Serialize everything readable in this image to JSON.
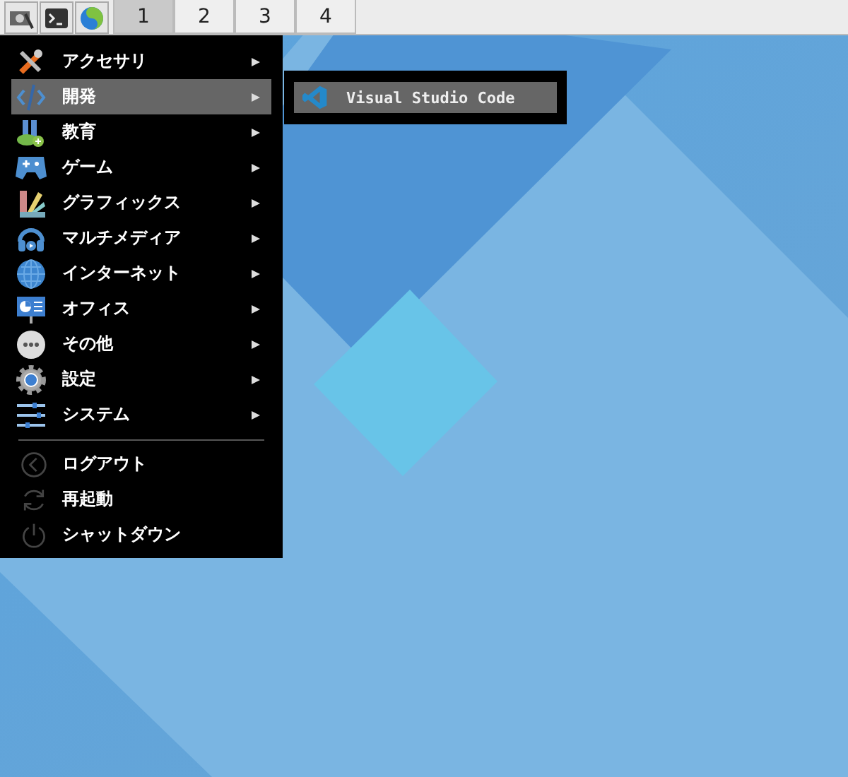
{
  "taskbar": {
    "workspaces": [
      {
        "label": "1",
        "selected": true
      },
      {
        "label": "2",
        "selected": false
      },
      {
        "label": "3",
        "selected": false
      },
      {
        "label": "4",
        "selected": false
      }
    ]
  },
  "menu": {
    "items": [
      {
        "label": "アクセサリ",
        "kind": "accessories",
        "selected": false,
        "has_submenu": true
      },
      {
        "label": "開発",
        "kind": "development",
        "selected": true,
        "has_submenu": true
      },
      {
        "label": "教育",
        "kind": "education",
        "selected": false,
        "has_submenu": true
      },
      {
        "label": "ゲーム",
        "kind": "games",
        "selected": false,
        "has_submenu": true
      },
      {
        "label": "グラフィックス",
        "kind": "graphics",
        "selected": false,
        "has_submenu": true
      },
      {
        "label": "マルチメディア",
        "kind": "multimedia",
        "selected": false,
        "has_submenu": true
      },
      {
        "label": "インターネット",
        "kind": "internet",
        "selected": false,
        "has_submenu": true
      },
      {
        "label": "オフィス",
        "kind": "office",
        "selected": false,
        "has_submenu": true
      },
      {
        "label": "その他",
        "kind": "other",
        "selected": false,
        "has_submenu": true
      },
      {
        "label": "設定",
        "kind": "settings",
        "selected": false,
        "has_submenu": true
      },
      {
        "label": "システム",
        "kind": "system",
        "selected": false,
        "has_submenu": true
      }
    ],
    "actions": [
      {
        "label": "ログアウト",
        "kind": "logout"
      },
      {
        "label": "再起動",
        "kind": "restart"
      },
      {
        "label": "シャットダウン",
        "kind": "shutdown"
      }
    ]
  },
  "submenu": {
    "items": [
      {
        "label": "Visual Studio Code",
        "kind": "vscode",
        "selected": true
      }
    ]
  }
}
